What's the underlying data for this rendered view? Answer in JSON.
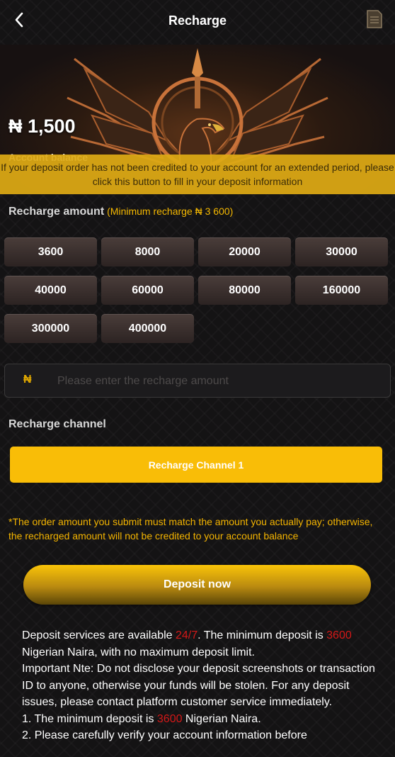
{
  "header": {
    "title": "Recharge",
    "back_icon": "chevron-left-icon",
    "records_icon": "document-icon"
  },
  "banner": {
    "balance": "₦ 1,500",
    "balance_label": "Account balance",
    "notice": "If your deposit order has not been credited to your account for an extended period, please click this button to fill in your deposit information"
  },
  "amount_section": {
    "title": "Recharge amount",
    "minimum": "(Minimum recharge ₦ 3 600)",
    "options": [
      "3600",
      "8000",
      "20000",
      "30000",
      "40000",
      "60000",
      "80000",
      "160000",
      "300000",
      "400000"
    ]
  },
  "input": {
    "currency_symbol": "₦",
    "placeholder": "Please enter the recharge amount",
    "value": ""
  },
  "channel_section": {
    "title": "Recharge channel",
    "channel_label": "Recharge Channel 1"
  },
  "warning": "*The order amount you submit must match the amount you actually pay; otherwise, the recharged amount will not be credited to your account balance",
  "deposit_button": "Deposit now",
  "info": {
    "l1_a": "Deposit services are available ",
    "l1_red": "24/7",
    "l1_b": ". The minimum deposit is ",
    "l1_red2": "3600",
    "l1_c": " Nigerian Naira, with no maximum deposit limit.",
    "l2": "Important Nte: Do not disclose your deposit screenshots or transaction ID to anyone, otherwise your funds will be stolen. For any deposit issues, please contact platform customer service immediately.",
    "l3_a": "1. The minimum deposit is ",
    "l3_red": "3600",
    "l3_b": " Nigerian Naira.",
    "l4": "2. Please carefully verify your account information before"
  },
  "colors": {
    "accent": "#f9bd07",
    "highlight": "#d41818",
    "background": "#141314"
  }
}
